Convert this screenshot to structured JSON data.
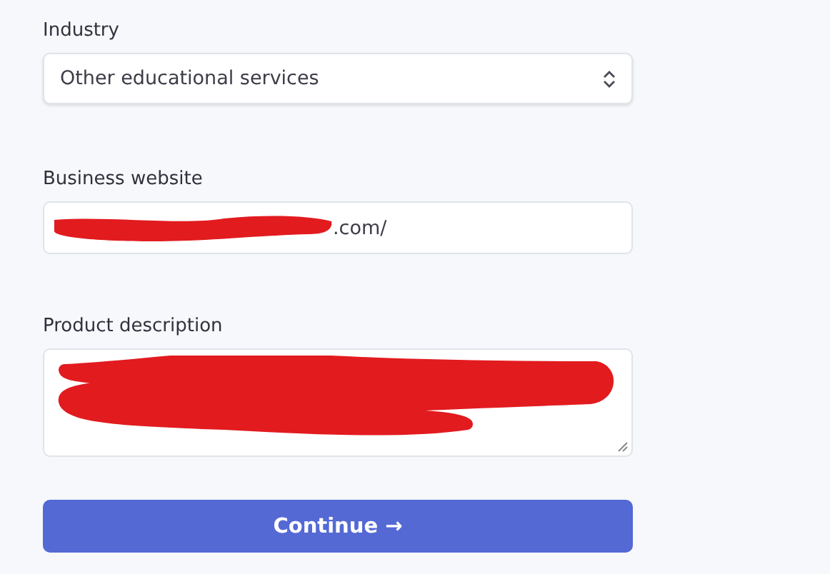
{
  "fields": [
    {
      "kind": "select",
      "label": "Industry",
      "value": "Other educational services"
    },
    {
      "kind": "text",
      "label": "Business website",
      "value": ".com/",
      "redacted": true
    },
    {
      "kind": "textarea",
      "label": "Product description",
      "redacted": true
    }
  ],
  "button": {
    "label": "Continue →"
  }
}
